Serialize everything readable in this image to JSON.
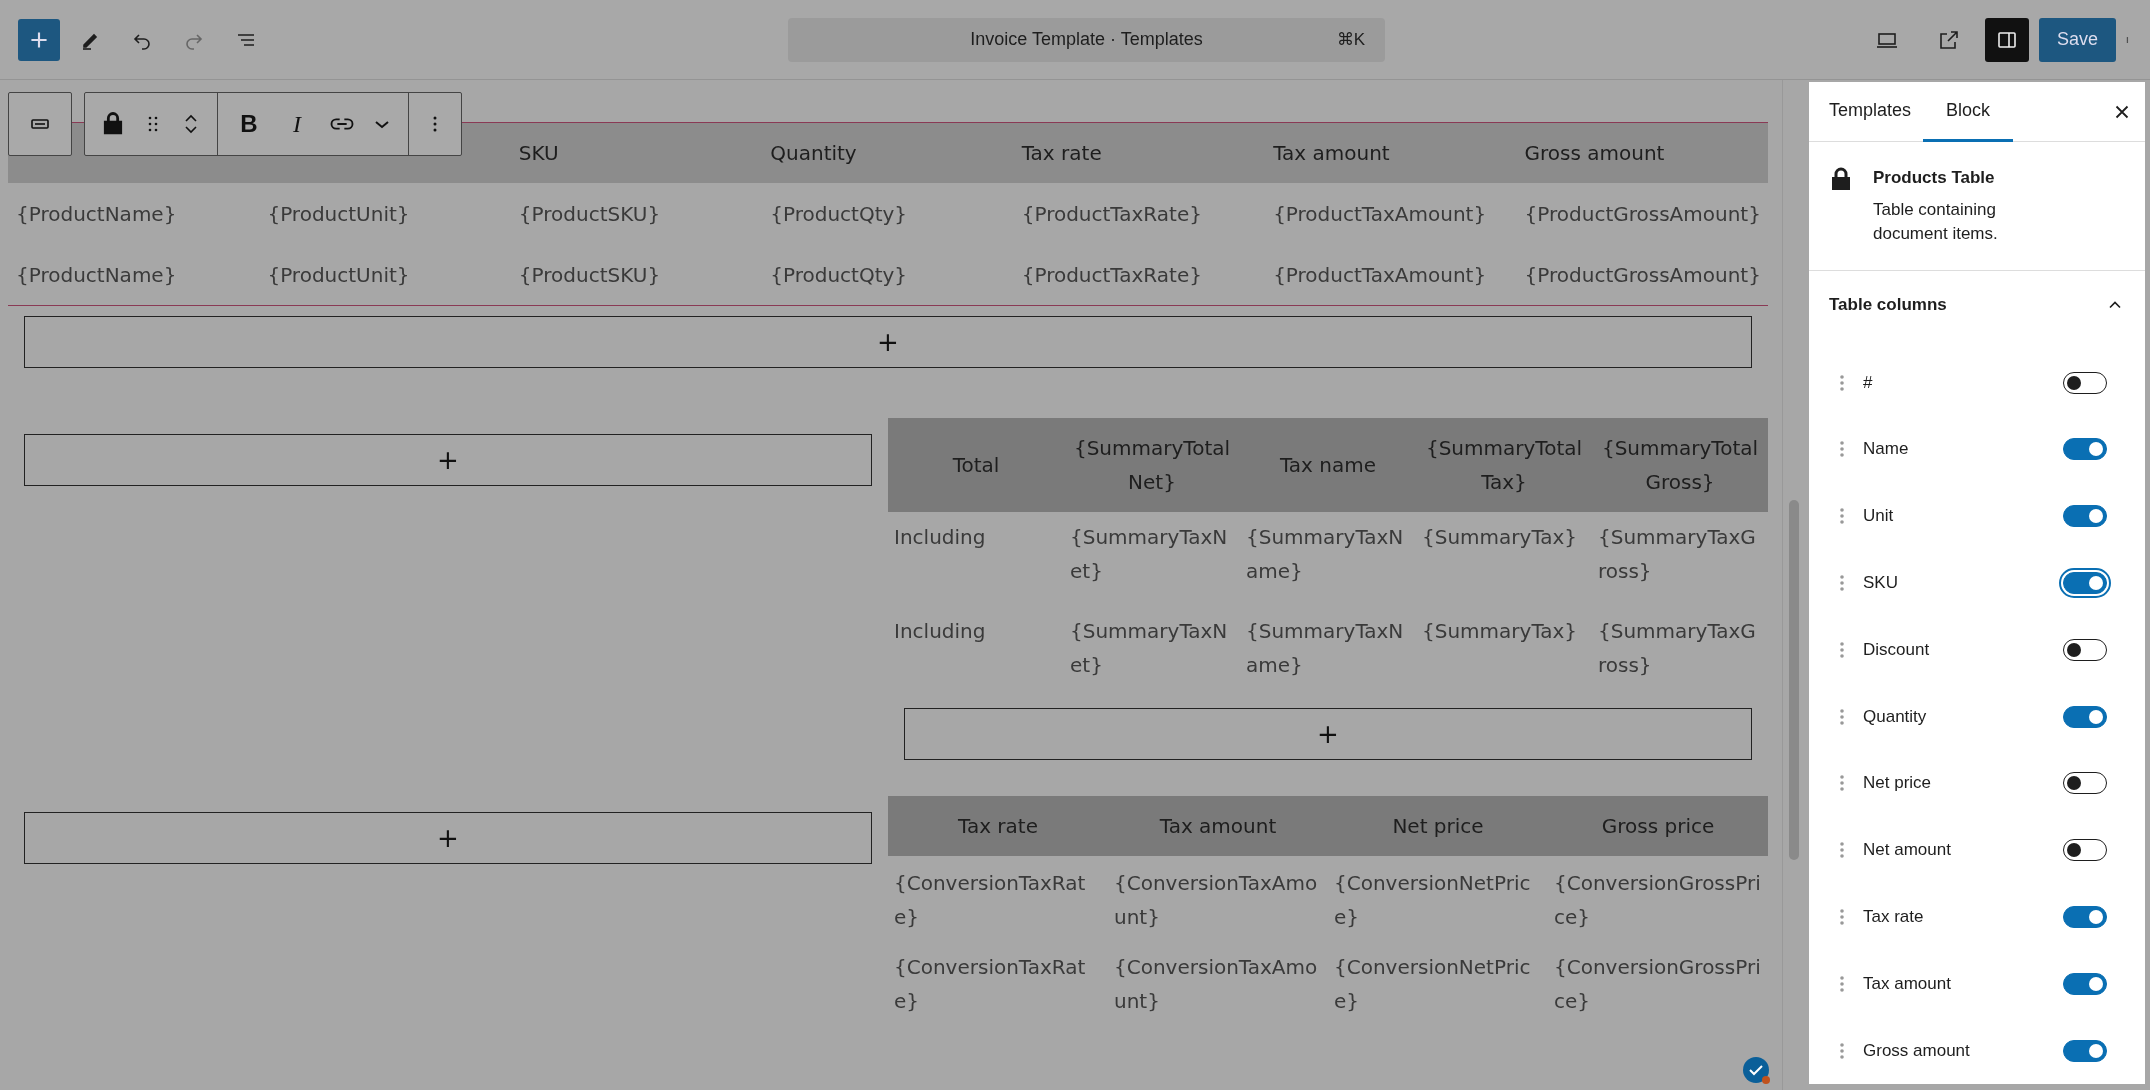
{
  "top_bar": {
    "title": "Invoice Template · Templates",
    "shortcut": "⌘K",
    "save": "Save"
  },
  "block_toolbar": {
    "format_buttons": [
      "B",
      "I"
    ]
  },
  "products_table": {
    "columns": [
      "",
      "",
      "SKU",
      "Quantity",
      "Tax rate",
      "Tax amount",
      "Gross amount"
    ],
    "rows": [
      [
        "{ProductName}",
        "{ProductUnit}",
        "{ProductSKU}",
        "{ProductQty}",
        "{ProductTaxRate}",
        "{ProductTaxAmount}",
        "{ProductGrossAmount}"
      ],
      [
        "{ProductName}",
        "{ProductUnit}",
        "{ProductSKU}",
        "{ProductQty}",
        "{ProductTaxRate}",
        "{ProductTaxAmount}",
        "{ProductGrossAmount}"
      ]
    ]
  },
  "add_block_label": "+",
  "summary_table": {
    "header": [
      "Total",
      "{SummaryTotalNet}",
      "Tax name",
      "{SummaryTotalTax}",
      "{SummaryTotalGross}"
    ],
    "rows": [
      [
        "Including",
        "{SummaryTaxNet}",
        "{SummaryTaxName}",
        "{SummaryTax}",
        "{SummaryTaxGross}"
      ],
      [
        "Including",
        "{SummaryTaxNet}",
        "{SummaryTaxName}",
        "{SummaryTax}",
        "{SummaryTaxGross}"
      ]
    ]
  },
  "conversion_table": {
    "columns": [
      "Tax rate",
      "Tax amount",
      "Net price",
      "Gross price"
    ],
    "rows": [
      [
        "{ConversionTaxRate}",
        "{ConversionTaxAmount}",
        "{ConversionNetPrice}",
        "{ConversionGrossPrice}"
      ],
      [
        "{ConversionTaxRate}",
        "{ConversionTaxAmount}",
        "{ConversionNetPrice}",
        "{ConversionGrossPrice}"
      ]
    ]
  },
  "sidebar": {
    "tabs": [
      {
        "label": "Templates",
        "selected": false
      },
      {
        "label": "Block",
        "selected": true
      }
    ],
    "block": {
      "title": "Products Table",
      "description": "Table containing document items."
    },
    "section": {
      "title": "Table columns",
      "expanded": true
    },
    "columns": [
      {
        "label": "#",
        "on": false,
        "focused": false
      },
      {
        "label": "Name",
        "on": true,
        "focused": false
      },
      {
        "label": "Unit",
        "on": true,
        "focused": false
      },
      {
        "label": "SKU",
        "on": true,
        "focused": true
      },
      {
        "label": "Discount",
        "on": false,
        "focused": false
      },
      {
        "label": "Quantity",
        "on": true,
        "focused": false
      },
      {
        "label": "Net price",
        "on": false,
        "focused": false
      },
      {
        "label": "Net amount",
        "on": false,
        "focused": false
      },
      {
        "label": "Tax rate",
        "on": true,
        "focused": false
      },
      {
        "label": "Tax amount",
        "on": true,
        "focused": false
      },
      {
        "label": "Gross amount",
        "on": true,
        "focused": false
      }
    ]
  }
}
